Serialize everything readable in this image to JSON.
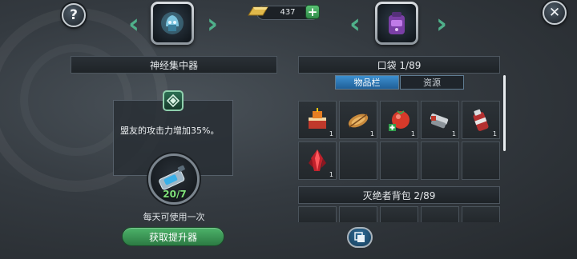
{
  "top_bar": {
    "help_label": "?",
    "close_label": "✕",
    "gold_amount": "437",
    "gold_plus_label": "+"
  },
  "left": {
    "title": "神经集中器",
    "effect_text": "盟友的攻击力增加35%。",
    "count": "20/7",
    "daily_text": "每天可使用一次",
    "acquire_button": "获取提升器"
  },
  "right": {
    "pocket_title": "口袋 1/89",
    "tabs": [
      {
        "label": "物品栏",
        "active": true
      },
      {
        "label": "资源",
        "active": false
      }
    ],
    "hunter_bag_title": "灭绝者背包 2/89",
    "grid_items": [
      {
        "icon": "birthday-cake-icon",
        "qty": "1"
      },
      {
        "icon": "roasted-meat-icon",
        "qty": "1"
      },
      {
        "icon": "tomato-medkit-icon",
        "qty": "1"
      },
      {
        "icon": "stapler-tool-icon",
        "qty": "1"
      },
      {
        "icon": "red-canister-icon",
        "qty": "1"
      },
      {
        "icon": "red-crystal-icon",
        "qty": "1"
      },
      {
        "icon": "",
        "qty": ""
      },
      {
        "icon": "",
        "qty": ""
      },
      {
        "icon": "",
        "qty": ""
      },
      {
        "icon": "",
        "qty": ""
      }
    ]
  },
  "colors": {
    "accent_green": "#4db36a",
    "tab_blue": "#3d8fd0",
    "count_green": "#7fe07a"
  }
}
